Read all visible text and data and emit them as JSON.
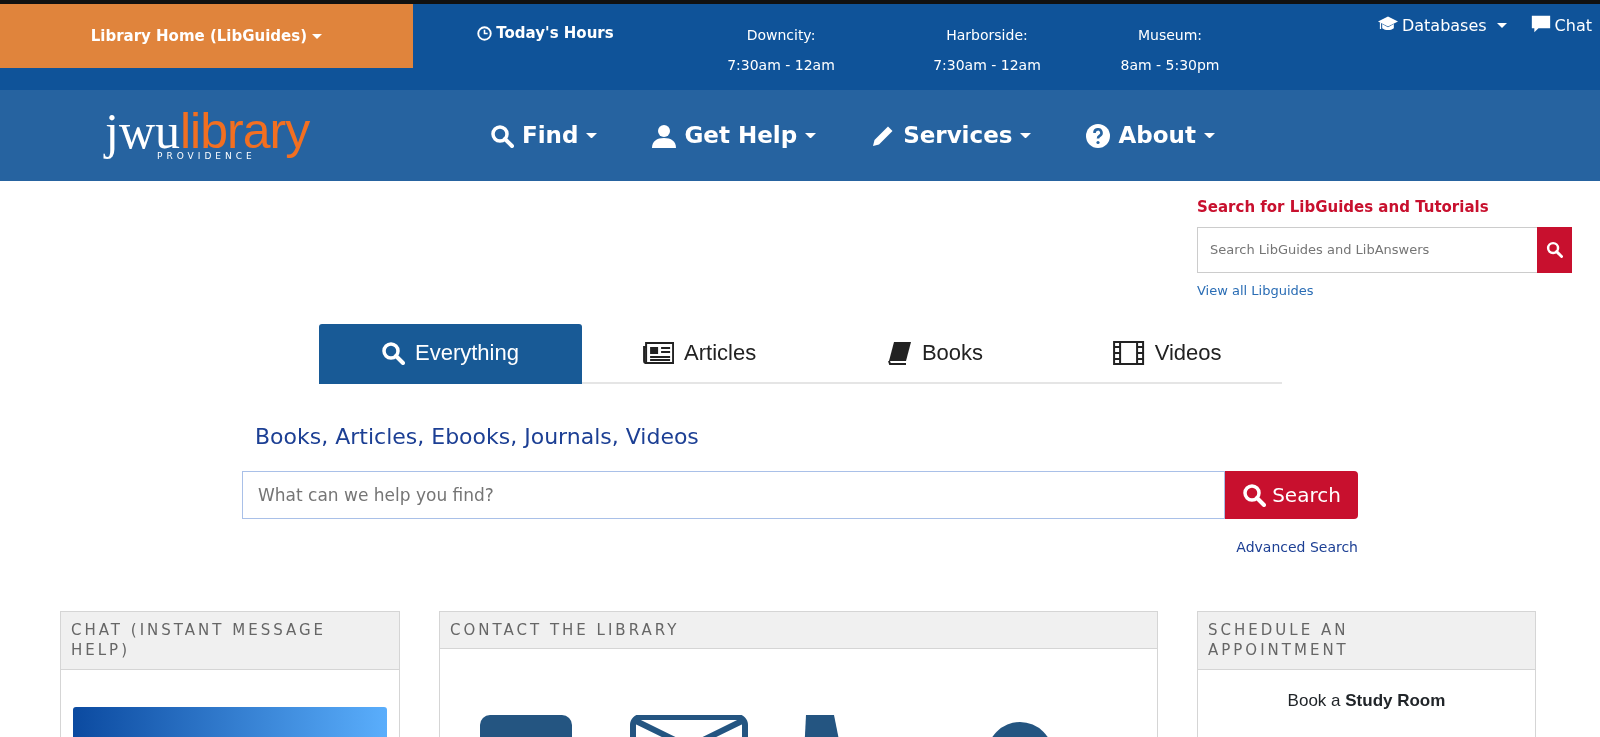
{
  "top_bar": {
    "home_menu": "Library Home (LibGuides)",
    "hours_title": "Today's Hours",
    "hours": [
      {
        "location": "Downcity:",
        "time": "7:30am - 12am"
      },
      {
        "location": "Harborside:",
        "time": "7:30am - 12am"
      },
      {
        "location": "Museum:",
        "time": "8am - 5:30pm"
      }
    ],
    "links": [
      {
        "kind": "databases",
        "label": "Databases",
        "dropdown": true
      },
      {
        "kind": "chat",
        "label": "Chat",
        "dropdown": false
      }
    ]
  },
  "logo": {
    "name": "jwu",
    "accent": "library",
    "subtitle": "PROVIDENCE"
  },
  "nav": [
    {
      "kind": "search",
      "label": "Find"
    },
    {
      "kind": "user",
      "label": "Get Help"
    },
    {
      "kind": "pencil",
      "label": "Services"
    },
    {
      "kind": "question",
      "label": "About"
    }
  ],
  "libguides_search": {
    "title": "Search for LibGuides and Tutorials",
    "placeholder": "Search LibGuides and LibAnswers",
    "link": "View all Libguides"
  },
  "tabs": [
    {
      "kind": "search",
      "label": "Everything",
      "selected": true
    },
    {
      "kind": "newspaper",
      "label": "Articles",
      "selected": false
    },
    {
      "kind": "book",
      "label": "Books",
      "selected": false
    },
    {
      "kind": "film",
      "label": "Videos",
      "selected": false
    }
  ],
  "search": {
    "heading": "Books, Articles, Ebooks, Journals, Videos",
    "placeholder": "What can we help you find?",
    "button": "Search",
    "advanced_link": "Advanced Search"
  },
  "cards": [
    {
      "kind": "image",
      "title": "CHAT (INSTANT MESSAGE HELP)"
    },
    {
      "kind": "icons",
      "title": "CONTACT THE LIBRARY"
    },
    {
      "kind": "text",
      "title": "SCHEDULE AN APPOINTMENT",
      "text": "Book a **Study Room**"
    }
  ]
}
